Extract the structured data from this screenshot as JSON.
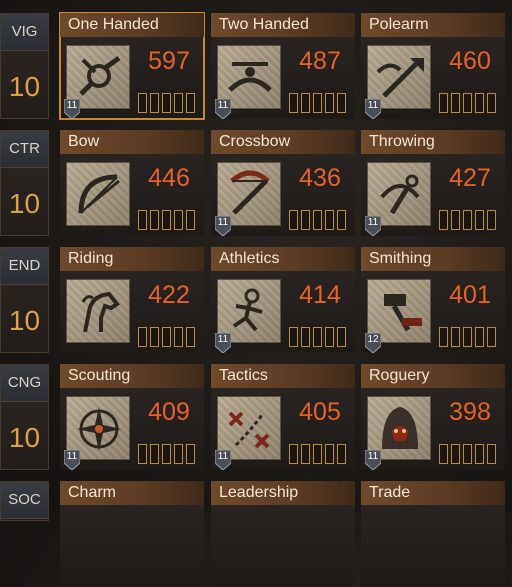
{
  "attributes": [
    {
      "abbr": "VIG",
      "value": "10"
    },
    {
      "abbr": "CTR",
      "value": "10"
    },
    {
      "abbr": "END",
      "value": "10"
    },
    {
      "abbr": "CNG",
      "value": "10"
    },
    {
      "abbr": "SOC",
      "value": ""
    }
  ],
  "skills": [
    [
      {
        "name": "One Handed",
        "value": "597",
        "badge": "11",
        "icon": "fist-icon",
        "selected": true
      },
      {
        "name": "Two Handed",
        "value": "487",
        "badge": "11",
        "icon": "two-handed-sword-icon"
      },
      {
        "name": "Polearm",
        "value": "460",
        "badge": "11",
        "icon": "polearm-icon"
      }
    ],
    [
      {
        "name": "Bow",
        "value": "446",
        "badge": "",
        "icon": "bow-icon"
      },
      {
        "name": "Crossbow",
        "value": "436",
        "badge": "11",
        "icon": "crossbow-icon"
      },
      {
        "name": "Throwing",
        "value": "427",
        "badge": "11",
        "icon": "throwing-icon"
      }
    ],
    [
      {
        "name": "Riding",
        "value": "422",
        "badge": "",
        "icon": "horse-icon"
      },
      {
        "name": "Athletics",
        "value": "414",
        "badge": "11",
        "icon": "runner-icon"
      },
      {
        "name": "Smithing",
        "value": "401",
        "badge": "12",
        "icon": "hammer-icon"
      }
    ],
    [
      {
        "name": "Scouting",
        "value": "409",
        "badge": "11",
        "icon": "compass-icon"
      },
      {
        "name": "Tactics",
        "value": "405",
        "badge": "11",
        "icon": "tactics-icon"
      },
      {
        "name": "Roguery",
        "value": "398",
        "badge": "11",
        "icon": "hood-icon"
      }
    ],
    [
      {
        "name": "Charm",
        "value": "",
        "badge": "",
        "icon": ""
      },
      {
        "name": "Leadership",
        "value": "",
        "badge": "",
        "icon": ""
      },
      {
        "name": "Trade",
        "value": "",
        "badge": "",
        "icon": ""
      }
    ]
  ],
  "focus_slots": 5,
  "colors": {
    "skill_value": "#e2622a",
    "attribute_value": "#d9a14a",
    "selected_border": "#c08a3a"
  }
}
